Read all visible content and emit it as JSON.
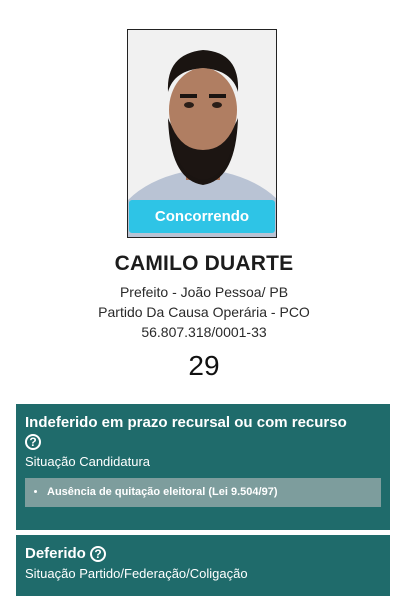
{
  "candidate": {
    "status_badge": "Concorrendo",
    "name": "CAMILO DUARTE",
    "office": "Prefeito - João Pessoa/ PB",
    "party": "Partido Da Causa Operária - PCO",
    "cnpj": "56.807.318/0001-33",
    "number": "29"
  },
  "candidacy_status": {
    "title": "Indeferido em prazo recursal ou com recurso",
    "subtitle": "Situação Candidatura",
    "reasons": [
      "Ausência de quitação eleitoral (Lei 9.504/97)"
    ]
  },
  "party_status": {
    "title": "Deferido",
    "subtitle": "Situação Partido/Federação/Coligação"
  },
  "colors": {
    "badge": "#2ec4e6",
    "status_box": "#1f6b6b",
    "reasons_box": "#7d9d9d"
  }
}
